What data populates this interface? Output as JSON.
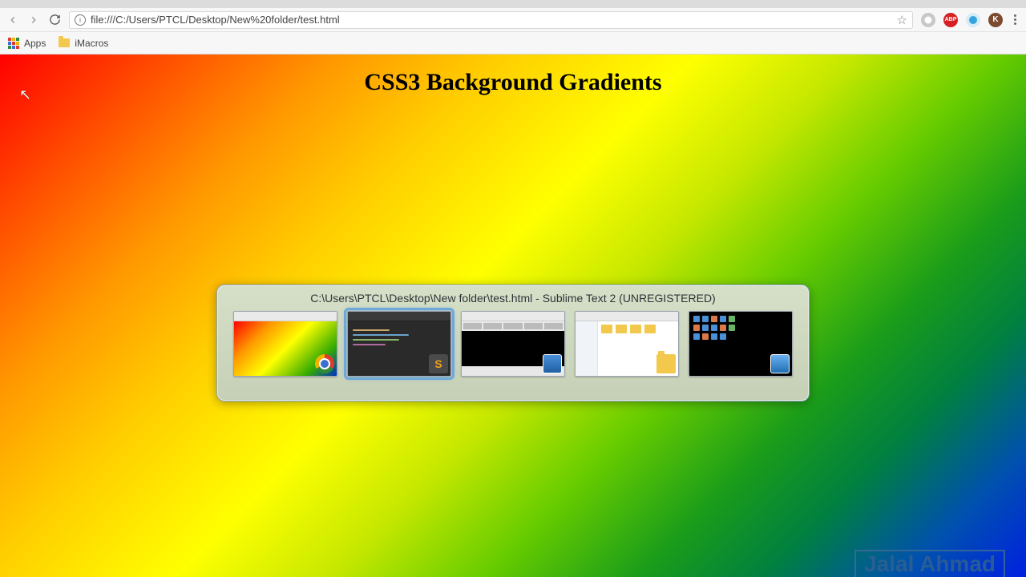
{
  "browser": {
    "url": "file:///C:/Users/PTCL/Desktop/New%20folder/test.html",
    "bookmarks": {
      "apps": "Apps",
      "imacros": "iMacros"
    },
    "extensions": {
      "abp": "ABP",
      "k": "K"
    }
  },
  "page": {
    "heading": "CSS3 Background Gradients"
  },
  "alttab": {
    "title": "C:\\Users\\PTCL\\Desktop\\New folder\\test.html - Sublime Text 2 (UNREGISTERED)",
    "sublime_badge": "S"
  },
  "watermark": "Jalal Ahmad"
}
